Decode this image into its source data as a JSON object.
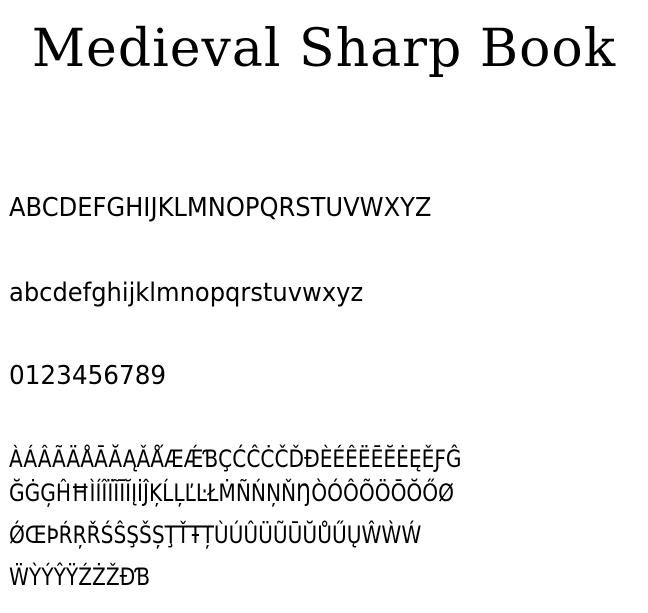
{
  "title": "Medieval Sharp Book",
  "samples": {
    "uppercase": "ABCDEFGHIJKLMNOPQRSTUVWXYZ",
    "lowercase": "abcdefghijklmnopqrstuvwxyz",
    "digits": "0123456789",
    "extended": [
      "ÀÁÂÃÄÅĀĂĄǍǺÆǼƁÇĆĈĊČĎĐÈÉÊËĒĔĖĘĚƑĜ",
      "ĞĠĢĤĦÌÍÎÏĨĪĬĮİĴĶĹĻĽĿŁṀÑŃŅŇŊÒÓÔÕÖŌŎŐØ",
      "ǾŒÞŔŖŘŚŜŞŠȘŢŤŦȚÙÚÛÜŨŪŬŮŰŲŴẀẂ",
      "ẄỲÝŶŸŹŻŽÐƁ"
    ]
  }
}
